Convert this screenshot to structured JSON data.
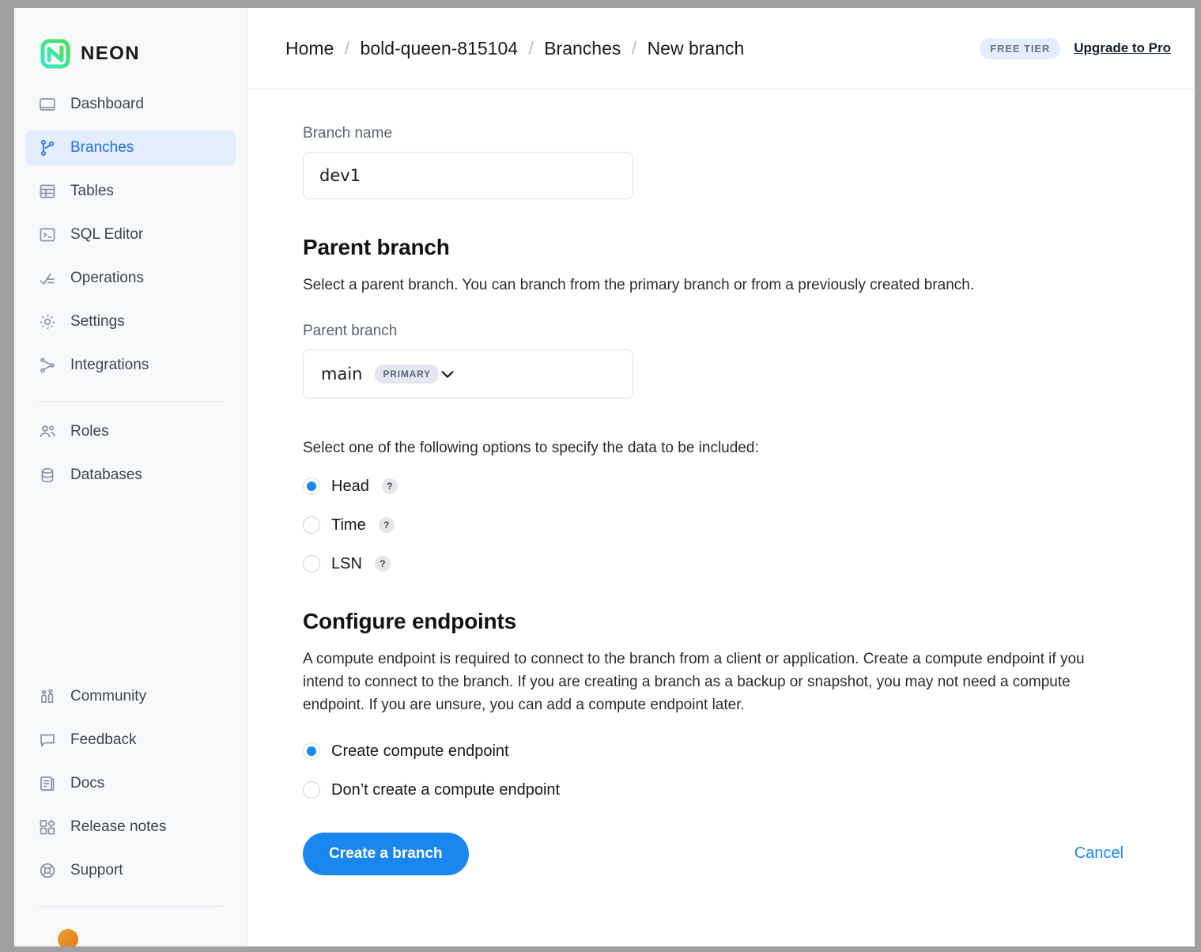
{
  "sidebar": {
    "brand": "NEON",
    "primary_items": [
      {
        "label": "Dashboard",
        "icon": "dashboard-icon",
        "active": false
      },
      {
        "label": "Branches",
        "icon": "branch-icon",
        "active": true
      },
      {
        "label": "Tables",
        "icon": "table-icon",
        "active": false
      },
      {
        "label": "SQL Editor",
        "icon": "sql-editor-icon",
        "active": false
      },
      {
        "label": "Operations",
        "icon": "operations-icon",
        "active": false
      },
      {
        "label": "Settings",
        "icon": "gear-icon",
        "active": false
      },
      {
        "label": "Integrations",
        "icon": "integrations-icon",
        "active": false
      }
    ],
    "secondary_items": [
      {
        "label": "Roles",
        "icon": "users-icon"
      },
      {
        "label": "Databases",
        "icon": "database-icon"
      }
    ],
    "bottom_items": [
      {
        "label": "Community",
        "icon": "community-icon"
      },
      {
        "label": "Feedback",
        "icon": "speech-bubble-icon"
      },
      {
        "label": "Docs",
        "icon": "document-icon"
      },
      {
        "label": "Release notes",
        "icon": "release-notes-icon"
      },
      {
        "label": "Support",
        "icon": "lifebuoy-icon"
      }
    ]
  },
  "header": {
    "breadcrumb": [
      {
        "label": "Home"
      },
      {
        "label": "bold-queen-815104"
      },
      {
        "label": "Branches"
      },
      {
        "label": "New branch"
      }
    ],
    "separator": "/",
    "tier_badge": "FREE TIER",
    "upgrade_link": "Upgrade to Pro"
  },
  "form": {
    "branch_name": {
      "label": "Branch name",
      "value": "dev1",
      "placeholder": "Branch name"
    },
    "parent_branch_section": {
      "title": "Parent branch",
      "description": "Select a parent branch. You can branch from the primary branch or from a previously created branch.",
      "select_label": "Parent branch",
      "selected_value": "main",
      "selected_badge": "PRIMARY",
      "options": [
        "main"
      ]
    },
    "data_options": {
      "prompt": "Select one of the following options to specify the data to be included:",
      "items": [
        {
          "label": "Head",
          "checked": true,
          "help": "?"
        },
        {
          "label": "Time",
          "checked": false,
          "help": "?"
        },
        {
          "label": "LSN",
          "checked": false,
          "help": "?"
        }
      ]
    },
    "endpoints_section": {
      "title": "Configure endpoints",
      "description": "A compute endpoint is required to connect to the branch from a client or application. Create a compute endpoint if you intend to connect to the branch. If you are creating a branch as a backup or snapshot, you may not need a compute endpoint. If you are unsure, you can add a compute endpoint later.",
      "items": [
        {
          "label": "Create compute endpoint",
          "checked": true
        },
        {
          "label": "Don’t create a compute endpoint",
          "checked": false
        }
      ]
    },
    "actions": {
      "submit_label": "Create a branch",
      "cancel_label": "Cancel"
    }
  },
  "colors": {
    "accent_blue": "#1a86f0",
    "active_nav_bg": "#e4edfd",
    "active_nav_text": "#1f6feb",
    "badge_bg": "#e5e7ee",
    "badge_text": "#5a6785",
    "logo_gradient_from": "#3ce6c8",
    "logo_gradient_to": "#4ade5a"
  }
}
